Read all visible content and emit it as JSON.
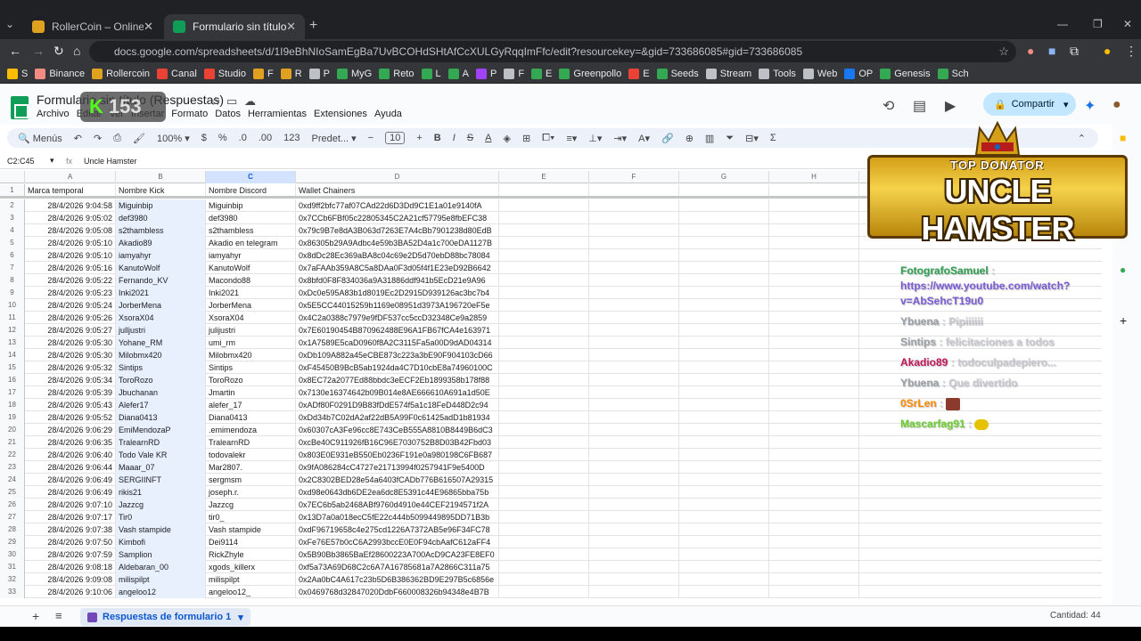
{
  "browser": {
    "tabs": [
      {
        "title": "RollerCoin – Online Bitcoin Mini",
        "active": false
      },
      {
        "title": "Formulario sin título (Respuesta",
        "active": true
      }
    ],
    "url": "docs.google.com/spreadsheets/d/1I9eBhNIoSamEgBa7UvBCOHdSHtAfCcXULGyRqqImFfc/edit?resourcekey=&gid=733686085#gid=733686085",
    "bookmarks": [
      "S",
      "Binance",
      "Rollercoin",
      "Canal",
      "Studio",
      "F",
      "R",
      "P",
      "MyG",
      "Reto",
      "L",
      "A",
      "P",
      "F",
      "E",
      "Greenpollo",
      "E",
      "Seeds",
      "Stream",
      "Tools",
      "Web",
      "OP",
      "Genesis",
      "Sch"
    ]
  },
  "sheets": {
    "title": "Formulario sin título (Respuestas)",
    "menu": [
      "Archivo",
      "Editar",
      "Ver",
      "Insertar",
      "Formato",
      "Datos",
      "Herramientas",
      "Extensiones",
      "Ayuda"
    ],
    "share_label": "Compartir",
    "toolbar": {
      "menus": "Menús",
      "zoom": "100%",
      "currency": "$",
      "percent": "%",
      "dec_less": ".0",
      "dec_more": ".00",
      "number_format": "123",
      "font": "Predet...",
      "font_size": "10"
    },
    "name_box": "C2:C45",
    "formula_value": "Uncle Hamster",
    "columns": [
      "A",
      "B",
      "C",
      "D",
      "E",
      "F",
      "G",
      "H",
      "I"
    ],
    "headers": [
      "Marca temporal",
      "Nombre Kick",
      "Nombre Discord",
      "Wallet Chainers"
    ],
    "rows": [
      [
        "28/4/2026 9:04:58",
        "Miguinbip",
        "Miguinbip",
        "0xd9ff2bfc77af07CAd22d6D3Dd9C1E1a01e9140fA"
      ],
      [
        "28/4/2026 9:05:02",
        "def3980",
        "def3980",
        "0x7CCb6FBf05c22805345C2A21cf57795e8fbEFC38"
      ],
      [
        "28/4/2026 9:05:08",
        "s2thambless",
        "s2thambless",
        "0x79c9B7e8dA3B063d7263E7A4cBb7901238d80EdB"
      ],
      [
        "28/4/2026 9:05:10",
        "Akadio89",
        "Akadio en telegram",
        "0x86305b29A9Adbc4e59b3BA52D4a1c700eDA1127B"
      ],
      [
        "28/4/2026 9:05:10",
        "iamyahyr",
        "iamyahyr",
        "0x8dDc28Ec369aBA8c04c69e2D5d70ebD88bc78084"
      ],
      [
        "28/4/2026 9:05:16",
        "KanutoWolf",
        "KanutoWolf",
        "0x7aFAAb359A8C5a8DAa0F3d05f4f1E23eD92B6642"
      ],
      [
        "28/4/2026 9:05:22",
        "Fernando_KV",
        "Macondo88",
        "0x8bfd0F8F834036a9A31886ddf941b5EcD21e9A96"
      ],
      [
        "28/4/2026 9:05:23",
        "Inki2021",
        "Inki2021",
        "0xDc0e595A83b1d8019Ec2D2915D939126ac3bc7b4"
      ],
      [
        "28/4/2026 9:05:24",
        "JorberMena",
        "JorberMena",
        "0x5E5CC44015259b1169e08951d3973A196720eF5e"
      ],
      [
        "28/4/2026 9:05:26",
        "XsoraX04",
        "XsoraX04",
        "0x4C2a0388c7979e9fDF537cc5ccD32348Ce9a2859"
      ],
      [
        "28/4/2026 9:05:27",
        "julljustri",
        "julijustri",
        "0x7E60190454B870962488E96A1FB67fCA4e163971"
      ],
      [
        "28/4/2026 9:05:30",
        "Yohane_RM",
        "umi_rm",
        "0x1A7589E5caD0960f8A2C3115Fa5a00D9dAD04314"
      ],
      [
        "28/4/2026 9:05:30",
        "Milobmx420",
        "Milobmx420",
        "0xDb109A882a45eCBE873c223a3bE90F904103cD66"
      ],
      [
        "28/4/2026 9:05:32",
        "Sintips",
        "Sintips",
        "0xF45450B9BcB5ab1924da4C7D10cbE8a74960100C"
      ],
      [
        "28/4/2026 9:05:34",
        "ToroRozo",
        "ToroRozo",
        "0x8EC72a2077Ed88bbdc3eECF2Eb1899358b178f88"
      ],
      [
        "28/4/2026 9:05:39",
        "Jbuchanan",
        "Jmartin",
        "0x7130e16374642b09B014e8AE666610A691a1d50E"
      ],
      [
        "28/4/2026 9:05:43",
        "Alefer17",
        "alefer_17",
        "0xADf80F0291D9B83fDdE574f5a1c18FeD448D2c94"
      ],
      [
        "28/4/2026 9:05:52",
        "Diana0413",
        "Diana0413",
        "0xDd34b7C02dA2af22dB5A99F0c61425adD1b81934"
      ],
      [
        "28/4/2026 9:06:29",
        "EmiMendozaP",
        ".emimendoza",
        "0x60307cA3Fe96cc8E743CeB555A8810B8449B6dC3"
      ],
      [
        "28/4/2026 9:06:35",
        "TralearnRD",
        "TralearnRD",
        "0xcBe40C911926fB16C96E7030752B8D03B42Fbd03"
      ],
      [
        "28/4/2026 9:06:40",
        "Todo Vale KR",
        "todovalekr",
        "0x803E0E931eB550Eb0236F191e0a980198C6FB687"
      ],
      [
        "28/4/2026 9:06:44",
        "Maaar_07",
        "Mar2807.",
        "0x9fA086284cC4727e21713994f0257941F9e5400D"
      ],
      [
        "28/4/2026 9:06:49",
        "SERGIINFT",
        "sergmsm",
        "0x2C8302BED28e54a6403fCADb776B616507A29315"
      ],
      [
        "28/4/2026 9:06:49",
        "rikis21",
        "joseph.r.",
        "0xd98e0643db6DE2ea6dc8E5391c44E96865bba75b"
      ],
      [
        "28/4/2026 9:07:10",
        "Jazzcg",
        "Jazzcg",
        "0x7EC6b5ab2468ABf9760d4910e44CEF2194571f2A"
      ],
      [
        "28/4/2026 9:07:17",
        "Tir0",
        "tir0_",
        "0x13D7a0a018ecC5fE22c444b5099449895DD71B3b"
      ],
      [
        "28/4/2026 9:07:38",
        "Vash stampide",
        "Vash stampide",
        "0xdF96719658c4e275cd1226A7372AB5e96F34FC78"
      ],
      [
        "28/4/2026 9:07:50",
        "Kimbofi",
        "Dei9114",
        "0xFe76E57b0cC6A2993bccE0E0F94cbAafC612aFF4"
      ],
      [
        "28/4/2026 9:07:59",
        "Samplion",
        "RickZhyle",
        "0x5B90Bb3865BaEf28600223A700AcD9CA23FE8EF0"
      ],
      [
        "28/4/2026 9:08:18",
        "Aldebaran_00",
        "xgods_killerx",
        "0xf5a73A69D68C2c6A7A16785681a7A2866C311a75"
      ],
      [
        "28/4/2026 9:09:08",
        "milispilpt",
        "milispilpt",
        "0x2Aa0bC4A617c23b5D6B386362BD9E297B5c6856e"
      ],
      [
        "28/4/2026 9:10:06",
        "angeloo12",
        "angeloo12_",
        "0x0469768d32847020DdbF660008326b94348e4B7B"
      ]
    ],
    "sheet_tab": "Respuestas de formulario 1",
    "count": "Cantidad: 44"
  },
  "overlay": {
    "kick_badge": "153",
    "donator_title": "TOP DONATOR",
    "donator_name": "UNCLE HAMSTER",
    "chat": [
      {
        "user": "FotografoSamuel",
        "text": "https://www.youtube.com/watch?v=AbSehcT19u0",
        "color": "#2e9e4f"
      },
      {
        "user": "Ybuena",
        "text": "Pipiiiiii",
        "color": "#9aa0a6"
      },
      {
        "user": "Sintips",
        "text": "felicitaciones a todos",
        "color": "#9aa0a6"
      },
      {
        "user": "Akadio89",
        "text": "todoculpadepiero...",
        "color": "#c2185b"
      },
      {
        "user": "Ybuena",
        "text": "Que divertido",
        "color": "#9aa0a6"
      },
      {
        "user": "0SrLen",
        "text": "",
        "color": "#ff8a00"
      },
      {
        "user": "Mascarfag91",
        "text": "",
        "color": "#6ccf2e"
      }
    ]
  }
}
